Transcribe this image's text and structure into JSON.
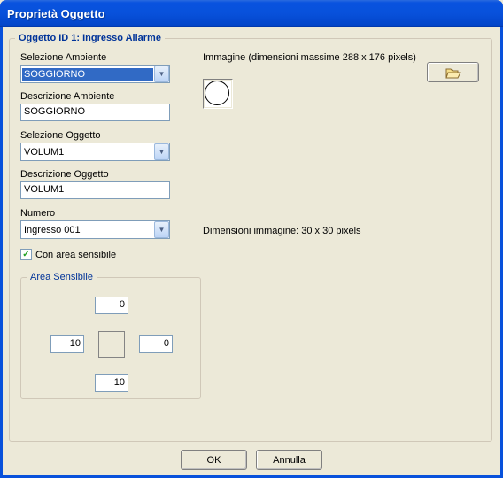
{
  "window": {
    "title": "Proprietà Oggetto"
  },
  "group": {
    "legend": "Oggetto ID 1: Ingresso Allarme"
  },
  "labels": {
    "selezione_ambiente": "Selezione Ambiente",
    "descrizione_ambiente": "Descrizione Ambiente",
    "selezione_oggetto": "Selezione Oggetto",
    "descrizione_oggetto": "Descrizione Oggetto",
    "numero": "Numero",
    "con_area_sensibile": "Con area sensibile",
    "area_sensibile": "Area Sensibile",
    "immagine": "Immagine (dimensioni massime 288 x 176 pixels)",
    "dimensioni": "Dimensioni immagine: 30 x 30 pixels"
  },
  "fields": {
    "selezione_ambiente": "SOGGIORNO",
    "descrizione_ambiente": "SOGGIORNO",
    "selezione_oggetto": "VOLUM1",
    "descrizione_oggetto": "VOLUM1",
    "numero": "Ingresso 001"
  },
  "area": {
    "top": "0",
    "left": "10",
    "right": "0",
    "bottom": "10"
  },
  "checkbox": {
    "con_area_sensibile": true
  },
  "buttons": {
    "ok": "OK",
    "annulla": "Annulla"
  }
}
